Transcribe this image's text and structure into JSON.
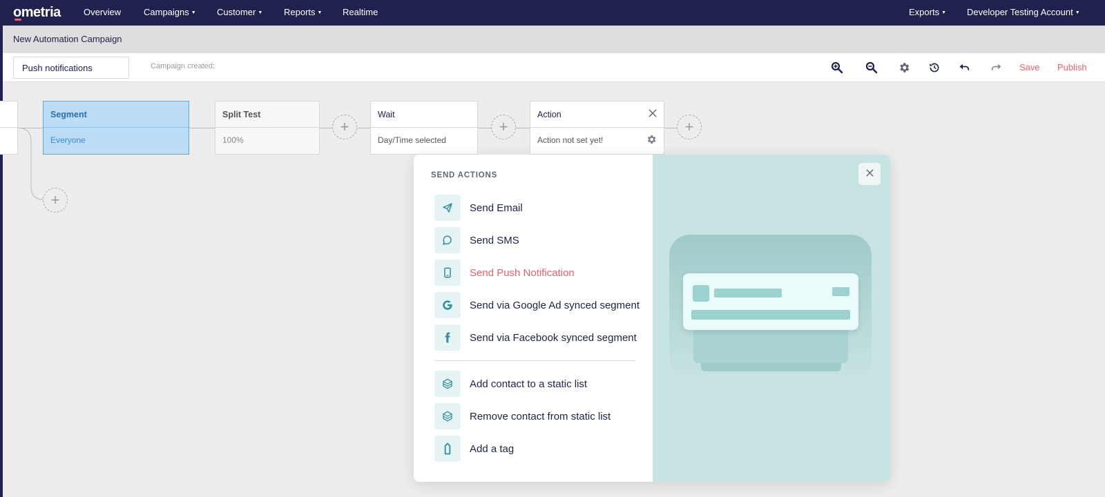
{
  "app": {
    "logo": "ometria"
  },
  "nav": {
    "items": [
      {
        "label": "Overview",
        "caret": false
      },
      {
        "label": "Campaigns",
        "caret": true
      },
      {
        "label": "Customer",
        "caret": true
      },
      {
        "label": "Reports",
        "caret": true
      },
      {
        "label": "Realtime",
        "caret": false
      }
    ],
    "right": [
      {
        "label": "Exports",
        "caret": true
      },
      {
        "label": "Developer Testing Account",
        "caret": true
      }
    ]
  },
  "subheader": {
    "title": "New Automation Campaign"
  },
  "toolbar": {
    "campaign_name": "Push notifications",
    "created_label": "Campaign created:",
    "icons": [
      "zoom-in-icon",
      "zoom-out-icon",
      "gear-icon",
      "history-icon",
      "undo-icon",
      "redo-icon"
    ],
    "save_label": "Save",
    "publish_label": "Publish"
  },
  "flow": {
    "segment": {
      "title": "Segment",
      "value": "Everyone"
    },
    "split_test": {
      "title": "Split Test",
      "value": "100%"
    },
    "wait": {
      "title": "Wait",
      "value": "Day/Time selected"
    },
    "action": {
      "title": "Action",
      "value": "Action not set yet!"
    }
  },
  "modal": {
    "section_title": "SEND ACTIONS",
    "send_actions": [
      {
        "label": "Send Email",
        "icon": "paper-plane-icon",
        "active": false
      },
      {
        "label": "Send SMS",
        "icon": "chat-bubble-icon",
        "active": false
      },
      {
        "label": "Send Push Notification",
        "icon": "mobile-phone-icon",
        "active": true
      },
      {
        "label": "Send via Google Ad synced segment",
        "icon": "google-icon",
        "active": false
      },
      {
        "label": "Send via Facebook synced segment",
        "icon": "facebook-icon",
        "active": false
      }
    ],
    "list_actions": [
      {
        "label": "Add contact to a static list",
        "icon": "cube-icon"
      },
      {
        "label": "Remove contact from static list",
        "icon": "cube-icon"
      },
      {
        "label": "Add a tag",
        "icon": "tag-icon"
      }
    ]
  },
  "colors": {
    "nav_bg": "#21214f",
    "accent_red": "#f0616a",
    "teal_panel": "#c7e3e2",
    "icon_teal": "#2f8f9e",
    "segment_blue": "#bddcf5"
  }
}
